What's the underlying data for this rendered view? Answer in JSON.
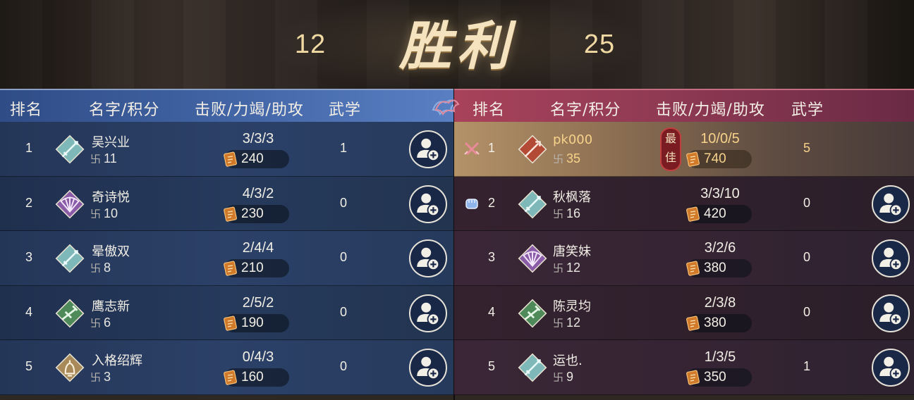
{
  "header": {
    "title": "胜利",
    "score_left": "12",
    "score_right": "25"
  },
  "columns": {
    "rank": "排名",
    "name_points": "名字/积分",
    "kda": "击败/力竭/助攻",
    "martial": "武学"
  },
  "blue_team": {
    "accent": "#4467a8",
    "players": [
      {
        "rank": "1",
        "name": "吴兴业",
        "points": "11",
        "kda": "3/3/3",
        "gold": "240",
        "martial": "1",
        "class_icon": "sword-icon"
      },
      {
        "rank": "2",
        "name": "奇诗悦",
        "points": "10",
        "kda": "4/3/2",
        "gold": "230",
        "martial": "0",
        "class_icon": "fan-icon"
      },
      {
        "rank": "3",
        "name": "晕傲双",
        "points": "8",
        "kda": "2/4/4",
        "gold": "210",
        "martial": "0",
        "class_icon": "sword-icon"
      },
      {
        "rank": "4",
        "name": "鹰志新",
        "points": "6",
        "kda": "2/5/2",
        "gold": "190",
        "martial": "0",
        "class_icon": "blade-icon"
      },
      {
        "rank": "5",
        "name": "入格绍辉",
        "points": "3",
        "kda": "0/4/3",
        "gold": "160",
        "martial": "0",
        "class_icon": "bell-icon"
      }
    ]
  },
  "red_team": {
    "accent": "#a8425a",
    "mvp_label": "最佳",
    "players": [
      {
        "rank": "1",
        "name": "pk000",
        "points": "35",
        "kda": "10/0/5",
        "gold": "740",
        "martial": "5",
        "class_icon": "spear-icon",
        "badge": "crossed-swords-icon",
        "mvp": true
      },
      {
        "rank": "2",
        "name": "秋枫落",
        "points": "16",
        "kda": "3/3/10",
        "gold": "420",
        "martial": "0",
        "class_icon": "sword-icon",
        "badge": "fist-icon"
      },
      {
        "rank": "3",
        "name": "唐笑妹",
        "points": "12",
        "kda": "3/2/6",
        "gold": "380",
        "martial": "0",
        "class_icon": "fan-icon"
      },
      {
        "rank": "4",
        "name": "陈灵均",
        "points": "12",
        "kda": "2/3/8",
        "gold": "380",
        "martial": "0",
        "class_icon": "blade-icon"
      },
      {
        "rank": "5",
        "name": "运也.",
        "points": "9",
        "kda": "1/3/5",
        "gold": "350",
        "martial": "1",
        "class_icon": "sword-icon"
      }
    ]
  }
}
